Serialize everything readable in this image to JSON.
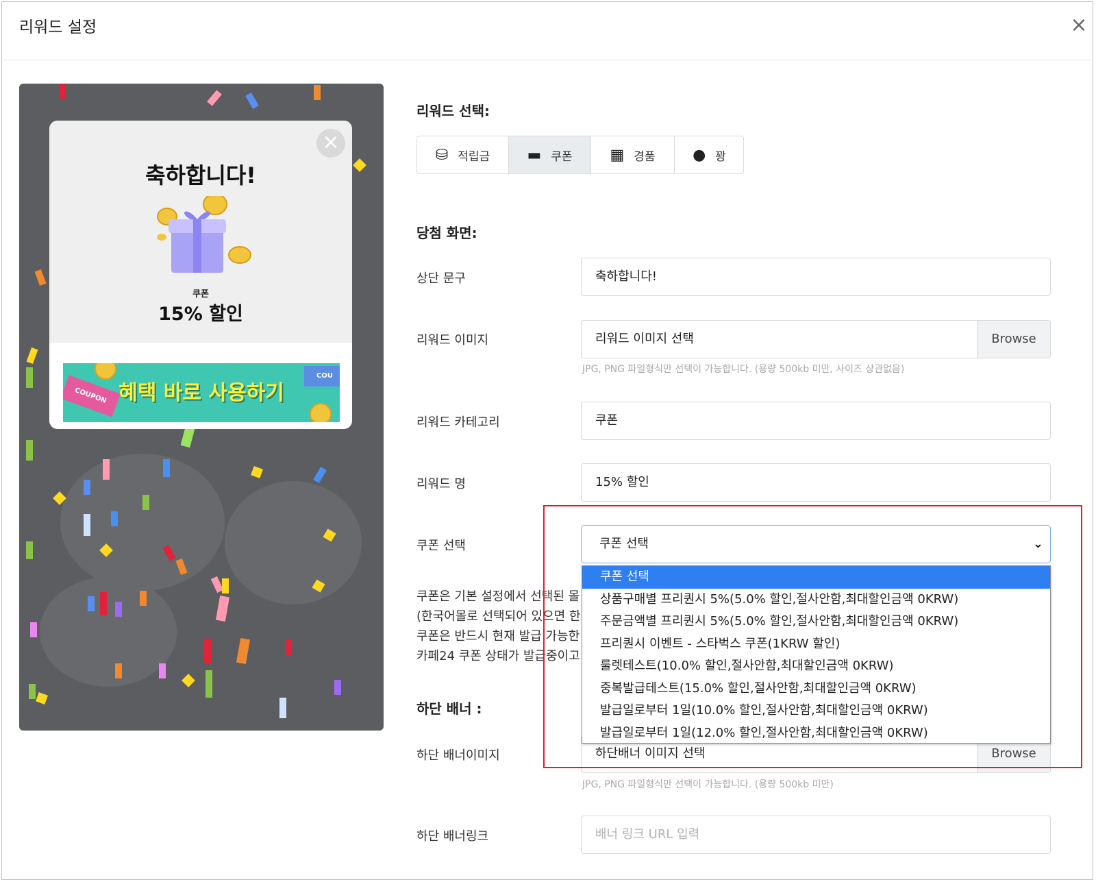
{
  "modal": {
    "title": "리워드 설정",
    "close_symbol": "×"
  },
  "preview": {
    "popup_title": "축하합니다!",
    "reward_category": "쿠폰",
    "reward_name": "15% 할인",
    "banner_text": "혜택 바로 사용하기",
    "banner_tag_left": "COUPON",
    "banner_tag_right": "COU",
    "close_symbol": "×"
  },
  "reward_select": {
    "label": "리워드 선택:",
    "tabs": [
      {
        "label": "적립금",
        "icon": "coins-icon",
        "active": false
      },
      {
        "label": "쿠폰",
        "icon": "ticket-icon",
        "active": true
      },
      {
        "label": "경품",
        "icon": "gift-icon",
        "active": false
      },
      {
        "label": "꽝",
        "icon": "bomb-icon",
        "active": false
      }
    ]
  },
  "win_screen": {
    "label": "당첨 화면:",
    "top_text": {
      "label": "상단 문구",
      "value": "축하합니다!"
    },
    "reward_image": {
      "label": "리워드 이미지",
      "placeholder": "리워드 이미지 선택",
      "browse": "Browse",
      "hint": "JPG, PNG 파일형식만 선택이 가능합니다. (용량 500kb 미만, 사이즈 상관없음)"
    },
    "reward_category": {
      "label": "리워드 카테고리",
      "value": "쿠폰"
    },
    "reward_name": {
      "label": "리워드 명",
      "value": "15% 할인"
    },
    "coupon_select": {
      "label": "쿠폰 선택",
      "selected": "쿠폰 선택",
      "options": [
        "쿠폰 선택",
        "상품구매별 프리퀀시 5%(5.0% 할인,절사안함,최대할인금액 0KRW)",
        "주문금액별 프리퀀시 5%(5.0% 할인,절사안함,최대할인금액 0KRW)",
        "프리퀀시 이벤트 - 스타벅스 쿠폰(1KRW 할인)",
        "룰렛테스트(10.0% 할인,절사안함,최대할인금액 0KRW)",
        "중복발급테스트(15.0% 할인,절사안함,최대할인금액 0KRW)",
        "발급일로부터 1일(10.0% 할인,절사안함,최대할인금액 0KRW)",
        "발급일로부터 1일(12.0% 할인,절사안함,최대할인금액 0KRW)"
      ]
    },
    "coupon_desc": [
      "쿠폰은 기본 설정에서 선택된 몰",
      "(한국어몰로 선택되어 있으면 한",
      "쿠폰은 반드시 현재 발급 가능한",
      "카페24 쿠폰 상태가 발급중이고"
    ]
  },
  "bottom_banner": {
    "label": "하단 배너 :",
    "image": {
      "label": "하단 배너이미지",
      "placeholder": "하단배너 이미지 선택",
      "browse": "Browse",
      "hint": "JPG, PNG 파일형식만 선택이 가능합니다. (용량 500kb 미만)"
    },
    "link": {
      "label": "하단 배너링크",
      "placeholder": "배너 링크 URL 입력"
    }
  }
}
